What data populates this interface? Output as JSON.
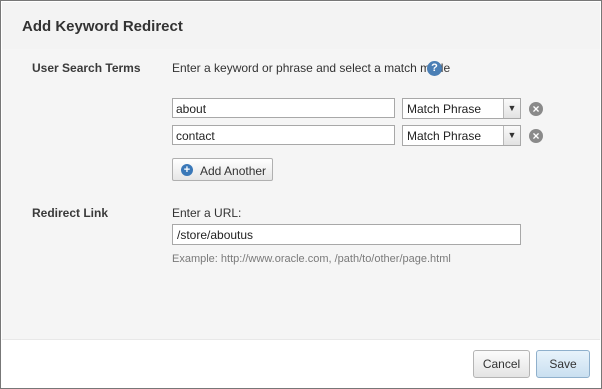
{
  "dialog": {
    "title": "Add Keyword Redirect"
  },
  "search_terms": {
    "label": "User Search Terms",
    "hint": "Enter a keyword or phrase and select a match mode",
    "help_icon": "question-circle-icon",
    "rows": [
      {
        "value": "about",
        "match_mode": "Match Phrase"
      },
      {
        "value": "contact",
        "match_mode": "Match Phrase"
      }
    ],
    "add_label": "Add Another"
  },
  "redirect": {
    "label": "Redirect Link",
    "hint": "Enter a URL:",
    "url": "/store/aboutus",
    "example": "Example: http://www.oracle.com, /path/to/other/page.html"
  },
  "footer": {
    "cancel_label": "Cancel",
    "save_label": "Save"
  },
  "colors": {
    "accent": "#3a78b8",
    "save_bg": "#c9dff0"
  }
}
